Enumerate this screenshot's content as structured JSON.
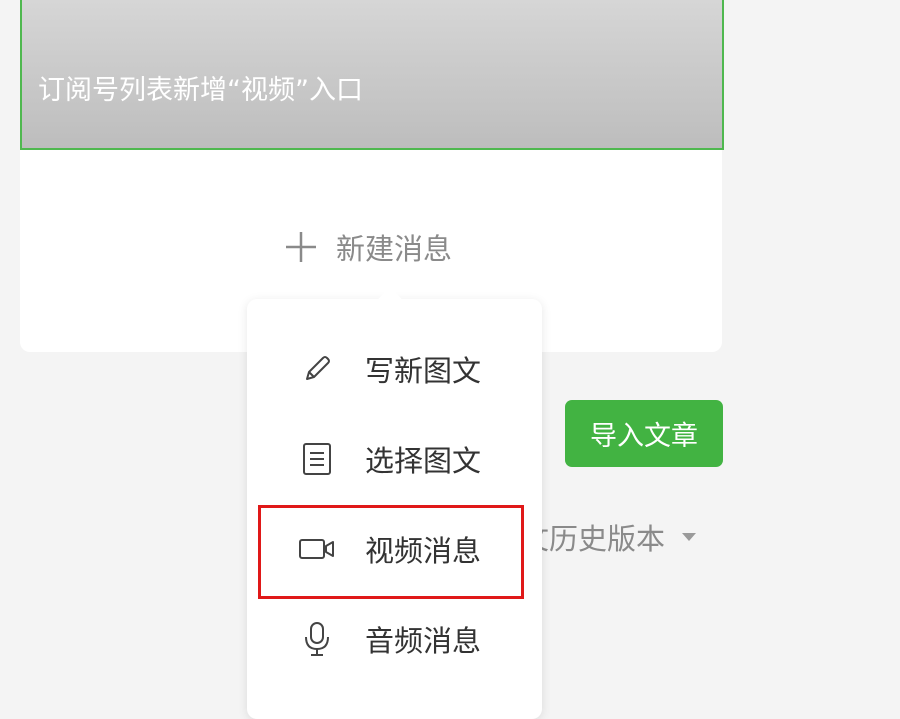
{
  "article": {
    "title": "订阅号列表新增“视频”入口"
  },
  "new_message": {
    "label": "新建消息"
  },
  "import_button": {
    "label": "导入文章"
  },
  "history": {
    "label": "文历史版本"
  },
  "menu": {
    "items": [
      {
        "label": "写新图文",
        "icon": "pencil-icon"
      },
      {
        "label": "选择图文",
        "icon": "document-icon"
      },
      {
        "label": "视频消息",
        "icon": "video-camera-icon"
      },
      {
        "label": "音频消息",
        "icon": "microphone-icon"
      }
    ]
  },
  "colors": {
    "accent": "#42b342",
    "highlight": "#e01818",
    "selection_border": "#4fb84f"
  }
}
